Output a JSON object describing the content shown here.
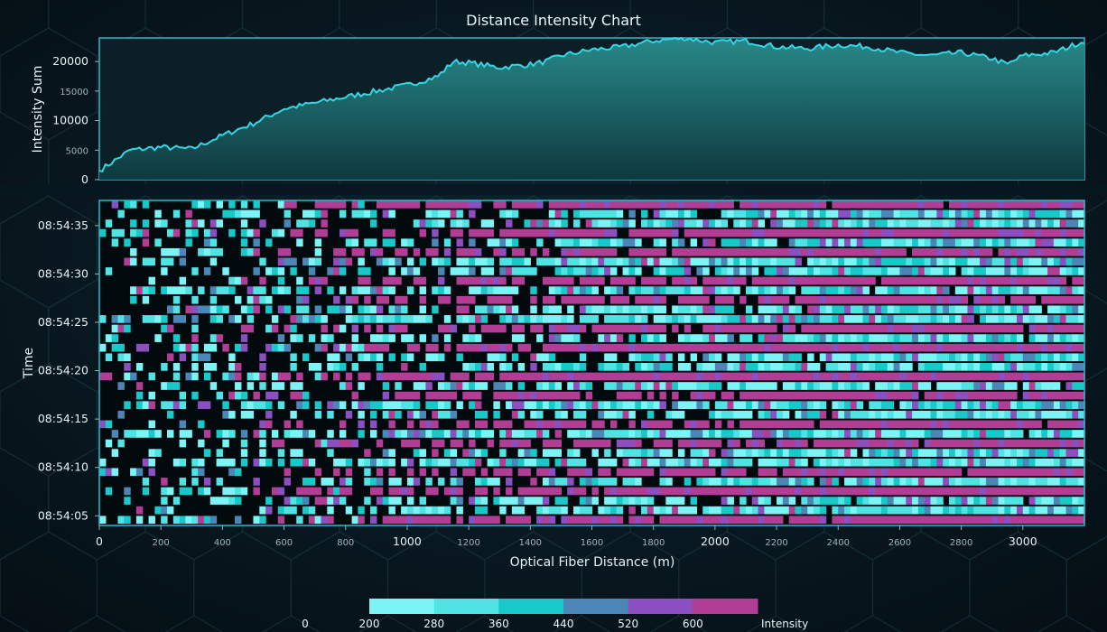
{
  "colors": {
    "line": "#35d6e4",
    "plot_border": "#2fb9c9",
    "heatmap_bg": "#030a0e",
    "scale": [
      "#7cf4f5",
      "#4fe3e4",
      "#19c8c8",
      "#4c86b6",
      "#8c4fbf",
      "#b23d95"
    ]
  },
  "chart_data": [
    {
      "type": "area",
      "title": "Distance Intensity Chart",
      "ylabel": "Intensity Sum",
      "xlim": [
        0,
        3200
      ],
      "ylim": [
        0,
        24000
      ],
      "y_ticks": [
        {
          "value": 0,
          "label": "0",
          "major": true
        },
        {
          "value": 5000,
          "label": "5000",
          "major": false
        },
        {
          "value": 10000,
          "label": "10000",
          "major": true
        },
        {
          "value": 15000,
          "label": "15000",
          "major": false
        },
        {
          "value": 20000,
          "label": "20000",
          "major": true
        }
      ],
      "x": [
        0,
        100,
        200,
        300,
        400,
        500,
        600,
        700,
        800,
        900,
        1000,
        1100,
        1150,
        1200,
        1300,
        1400,
        1450,
        1500,
        1600,
        1700,
        1800,
        1900,
        2000,
        2100,
        2200,
        2300,
        2400,
        2500,
        2600,
        2700,
        2800,
        2900,
        2950,
        3000,
        3100,
        3200
      ],
      "values": [
        1500,
        5000,
        5500,
        5200,
        7500,
        9500,
        12000,
        13000,
        14000,
        15000,
        16000,
        17500,
        20000,
        19800,
        19000,
        19500,
        20000,
        21000,
        22000,
        22500,
        23500,
        24000,
        23200,
        23500,
        22500,
        22200,
        22800,
        22500,
        21500,
        21000,
        21500,
        20500,
        19500,
        21000,
        21500,
        23500
      ]
    },
    {
      "type": "heatmap",
      "xlabel": "Optical Fiber Distance (m)",
      "ylabel": "Time",
      "xlim": [
        0,
        3200
      ],
      "x_ticks": [
        {
          "value": 0,
          "label": "0",
          "major": true
        },
        {
          "value": 200,
          "label": "200",
          "major": false
        },
        {
          "value": 400,
          "label": "400",
          "major": false
        },
        {
          "value": 600,
          "label": "600",
          "major": false
        },
        {
          "value": 800,
          "label": "800",
          "major": false
        },
        {
          "value": 1000,
          "label": "1000",
          "major": true
        },
        {
          "value": 1200,
          "label": "1200",
          "major": false
        },
        {
          "value": 1400,
          "label": "1400",
          "major": false
        },
        {
          "value": 1600,
          "label": "1600",
          "major": false
        },
        {
          "value": 1800,
          "label": "1800",
          "major": false
        },
        {
          "value": 2000,
          "label": "2000",
          "major": true
        },
        {
          "value": 2200,
          "label": "2200",
          "major": false
        },
        {
          "value": 2400,
          "label": "2400",
          "major": false
        },
        {
          "value": 2600,
          "label": "2600",
          "major": false
        },
        {
          "value": 2800,
          "label": "2800",
          "major": false
        },
        {
          "value": 3000,
          "label": "3000",
          "major": true
        }
      ],
      "time_range_s": [
        0,
        33.6
      ],
      "y_ticks": [
        {
          "value": 1,
          "label": "08:54:05"
        },
        {
          "value": 6,
          "label": "08:54:10"
        },
        {
          "value": 11,
          "label": "08:54:15"
        },
        {
          "value": 16,
          "label": "08:54:20"
        },
        {
          "value": 21,
          "label": "08:54:25"
        },
        {
          "value": 26,
          "label": "08:54:30"
        },
        {
          "value": 31,
          "label": "08:54:35"
        }
      ],
      "color_scale": {
        "title": "Intensity",
        "labels": [
          "0",
          "200",
          "280",
          "360",
          "440",
          "520",
          "600"
        ],
        "thresholds": [
          200,
          280,
          360,
          440,
          520,
          600,
          680
        ]
      }
    }
  ]
}
